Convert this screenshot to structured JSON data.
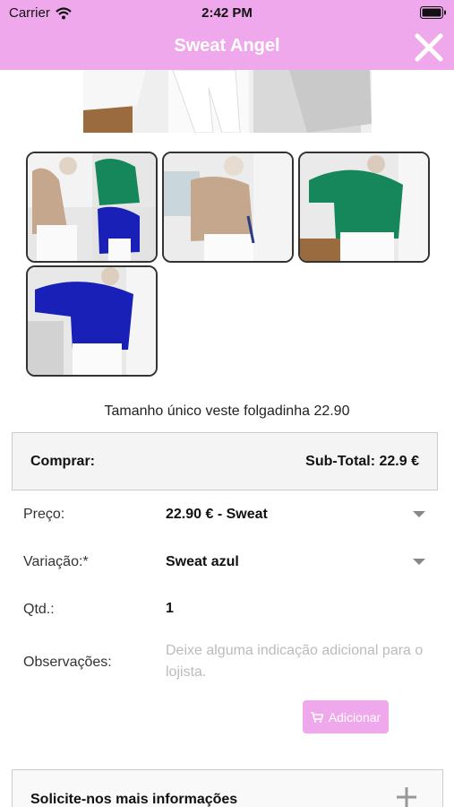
{
  "status": {
    "carrier": "Carrier",
    "time": "2:42 PM"
  },
  "nav": {
    "title": "Sweat Angel"
  },
  "product": {
    "description": "Tamanho único veste folgadinha 22.90"
  },
  "buy": {
    "label": "Comprar:",
    "subtotal": "Sub-Total: 22.9 €"
  },
  "form": {
    "price_label": "Preço:",
    "price_value": "22.90 € - Sweat",
    "variation_label": "Variação:*",
    "variation_value": "Sweat azul",
    "qty_label": "Qtd.:",
    "qty_value": "1",
    "notes_label": "Observações:",
    "notes_placeholder": "Deixe alguma indicação adicional para o lojista."
  },
  "add_button": {
    "label": "Adicionar"
  },
  "info": {
    "label": "Solicite-nos mais informações"
  },
  "colors": {
    "accent": "#f0a8ec",
    "sweat_beige": "#c4a78c",
    "sweat_green": "#16875a",
    "sweat_blue": "#1820b8"
  },
  "icons": [
    "wifi-icon",
    "battery-icon",
    "close-icon",
    "chevron-down-icon",
    "cart-icon",
    "plus-icon"
  ]
}
